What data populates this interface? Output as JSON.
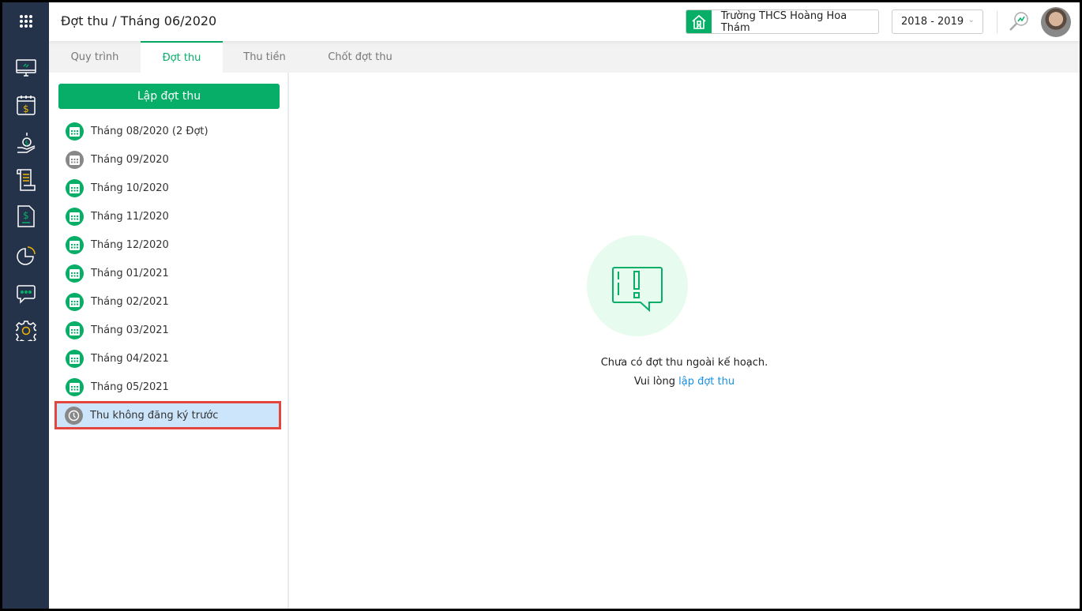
{
  "header": {
    "title": "Đợt thu / Tháng 06/2020",
    "school": "Trường THCS Hoàng Hoa Thám",
    "year": "2018 - 2019"
  },
  "sidebar": {
    "icons": [
      "apps-grid-icon",
      "dashboard-monitor-icon",
      "fee-calendar-icon",
      "payment-hand-icon",
      "receipt-scroll-icon",
      "invoice-document-icon",
      "report-pie-icon",
      "message-icon",
      "settings-gear-icon"
    ]
  },
  "tabs": [
    {
      "label": "Quy trình"
    },
    {
      "label": "Đợt thu",
      "active": true
    },
    {
      "label": "Thu tiền"
    },
    {
      "label": "Chốt đợt thu"
    }
  ],
  "left": {
    "create_button": "Lập đợt thu",
    "items": [
      {
        "label": "Tháng 08/2020 (2 Đợt)",
        "status": "green"
      },
      {
        "label": "Tháng 09/2020",
        "status": "gray"
      },
      {
        "label": "Tháng 10/2020",
        "status": "green"
      },
      {
        "label": "Tháng 11/2020",
        "status": "green"
      },
      {
        "label": "Tháng 12/2020",
        "status": "green"
      },
      {
        "label": "Tháng 01/2021",
        "status": "green"
      },
      {
        "label": "Tháng 02/2021",
        "status": "green"
      },
      {
        "label": "Tháng 03/2021",
        "status": "green"
      },
      {
        "label": "Tháng 04/2021",
        "status": "green"
      },
      {
        "label": "Tháng 05/2021",
        "status": "green"
      }
    ],
    "unregistered": "Thu không đăng ký trước"
  },
  "empty": {
    "message": "Chưa có đợt thu ngoài kế hoạch.",
    "prompt": "Vui lòng",
    "link": "lập đợt thu"
  },
  "colors": {
    "accent": "#06ae67",
    "sidebar": "#24324a",
    "link": "#1a8fe3",
    "selected": "#cce5fb",
    "highlight": "#e2463f"
  }
}
